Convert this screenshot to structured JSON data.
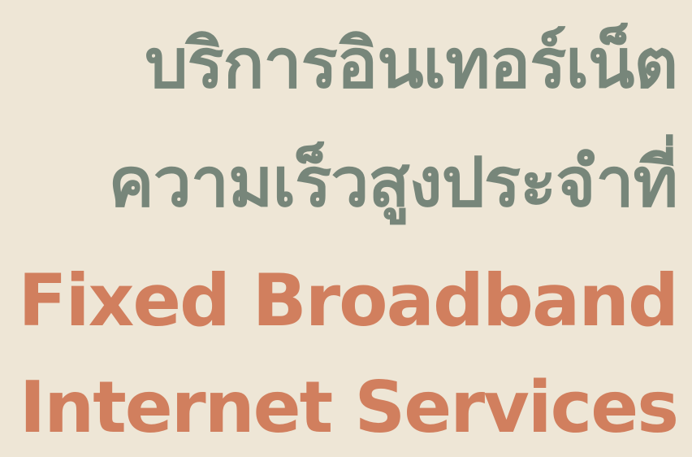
{
  "colors": {
    "background": "#EEE6D6",
    "thai_text": "#77867A",
    "english_text": "#D17F5E"
  },
  "heading": {
    "thai_line_1": "บริการอินเทอร์เน็ต",
    "thai_line_2": "ความเร็วสูงประจำที่",
    "english_line_1": "Fixed Broadband",
    "english_line_2": "Internet Services"
  }
}
